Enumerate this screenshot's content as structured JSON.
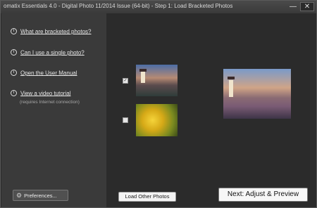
{
  "window": {
    "title": "omatix Essentials  4.0 - Digital Photo 11/2014 Issue (64-bit) - Step 1: Load Bracketed Photos",
    "minimize_glyph": "—",
    "close_glyph": "✕"
  },
  "sidebar": {
    "items": [
      {
        "label": "What are bracketed photos?",
        "icon": "info-icon"
      },
      {
        "label": "Can I use a single photo?",
        "icon": "info-icon"
      },
      {
        "label": "Open the User Manual",
        "icon": "info-icon"
      },
      {
        "label": "View a video tutorial",
        "icon": "info-icon"
      }
    ],
    "video_note": "(requires Internet connection)",
    "info_glyph": "i",
    "preferences_label": "Preferences...",
    "gear_glyph": "⚙"
  },
  "photos": [
    {
      "checked": true,
      "check_glyph": "✓",
      "subject": "lighthouse"
    },
    {
      "checked": false,
      "check_glyph": "",
      "subject": "yellow tulips"
    }
  ],
  "preview": {
    "subject": "lighthouse"
  },
  "buttons": {
    "load_other": "Load Other Photos",
    "next": "Next: Adjust & Preview"
  }
}
